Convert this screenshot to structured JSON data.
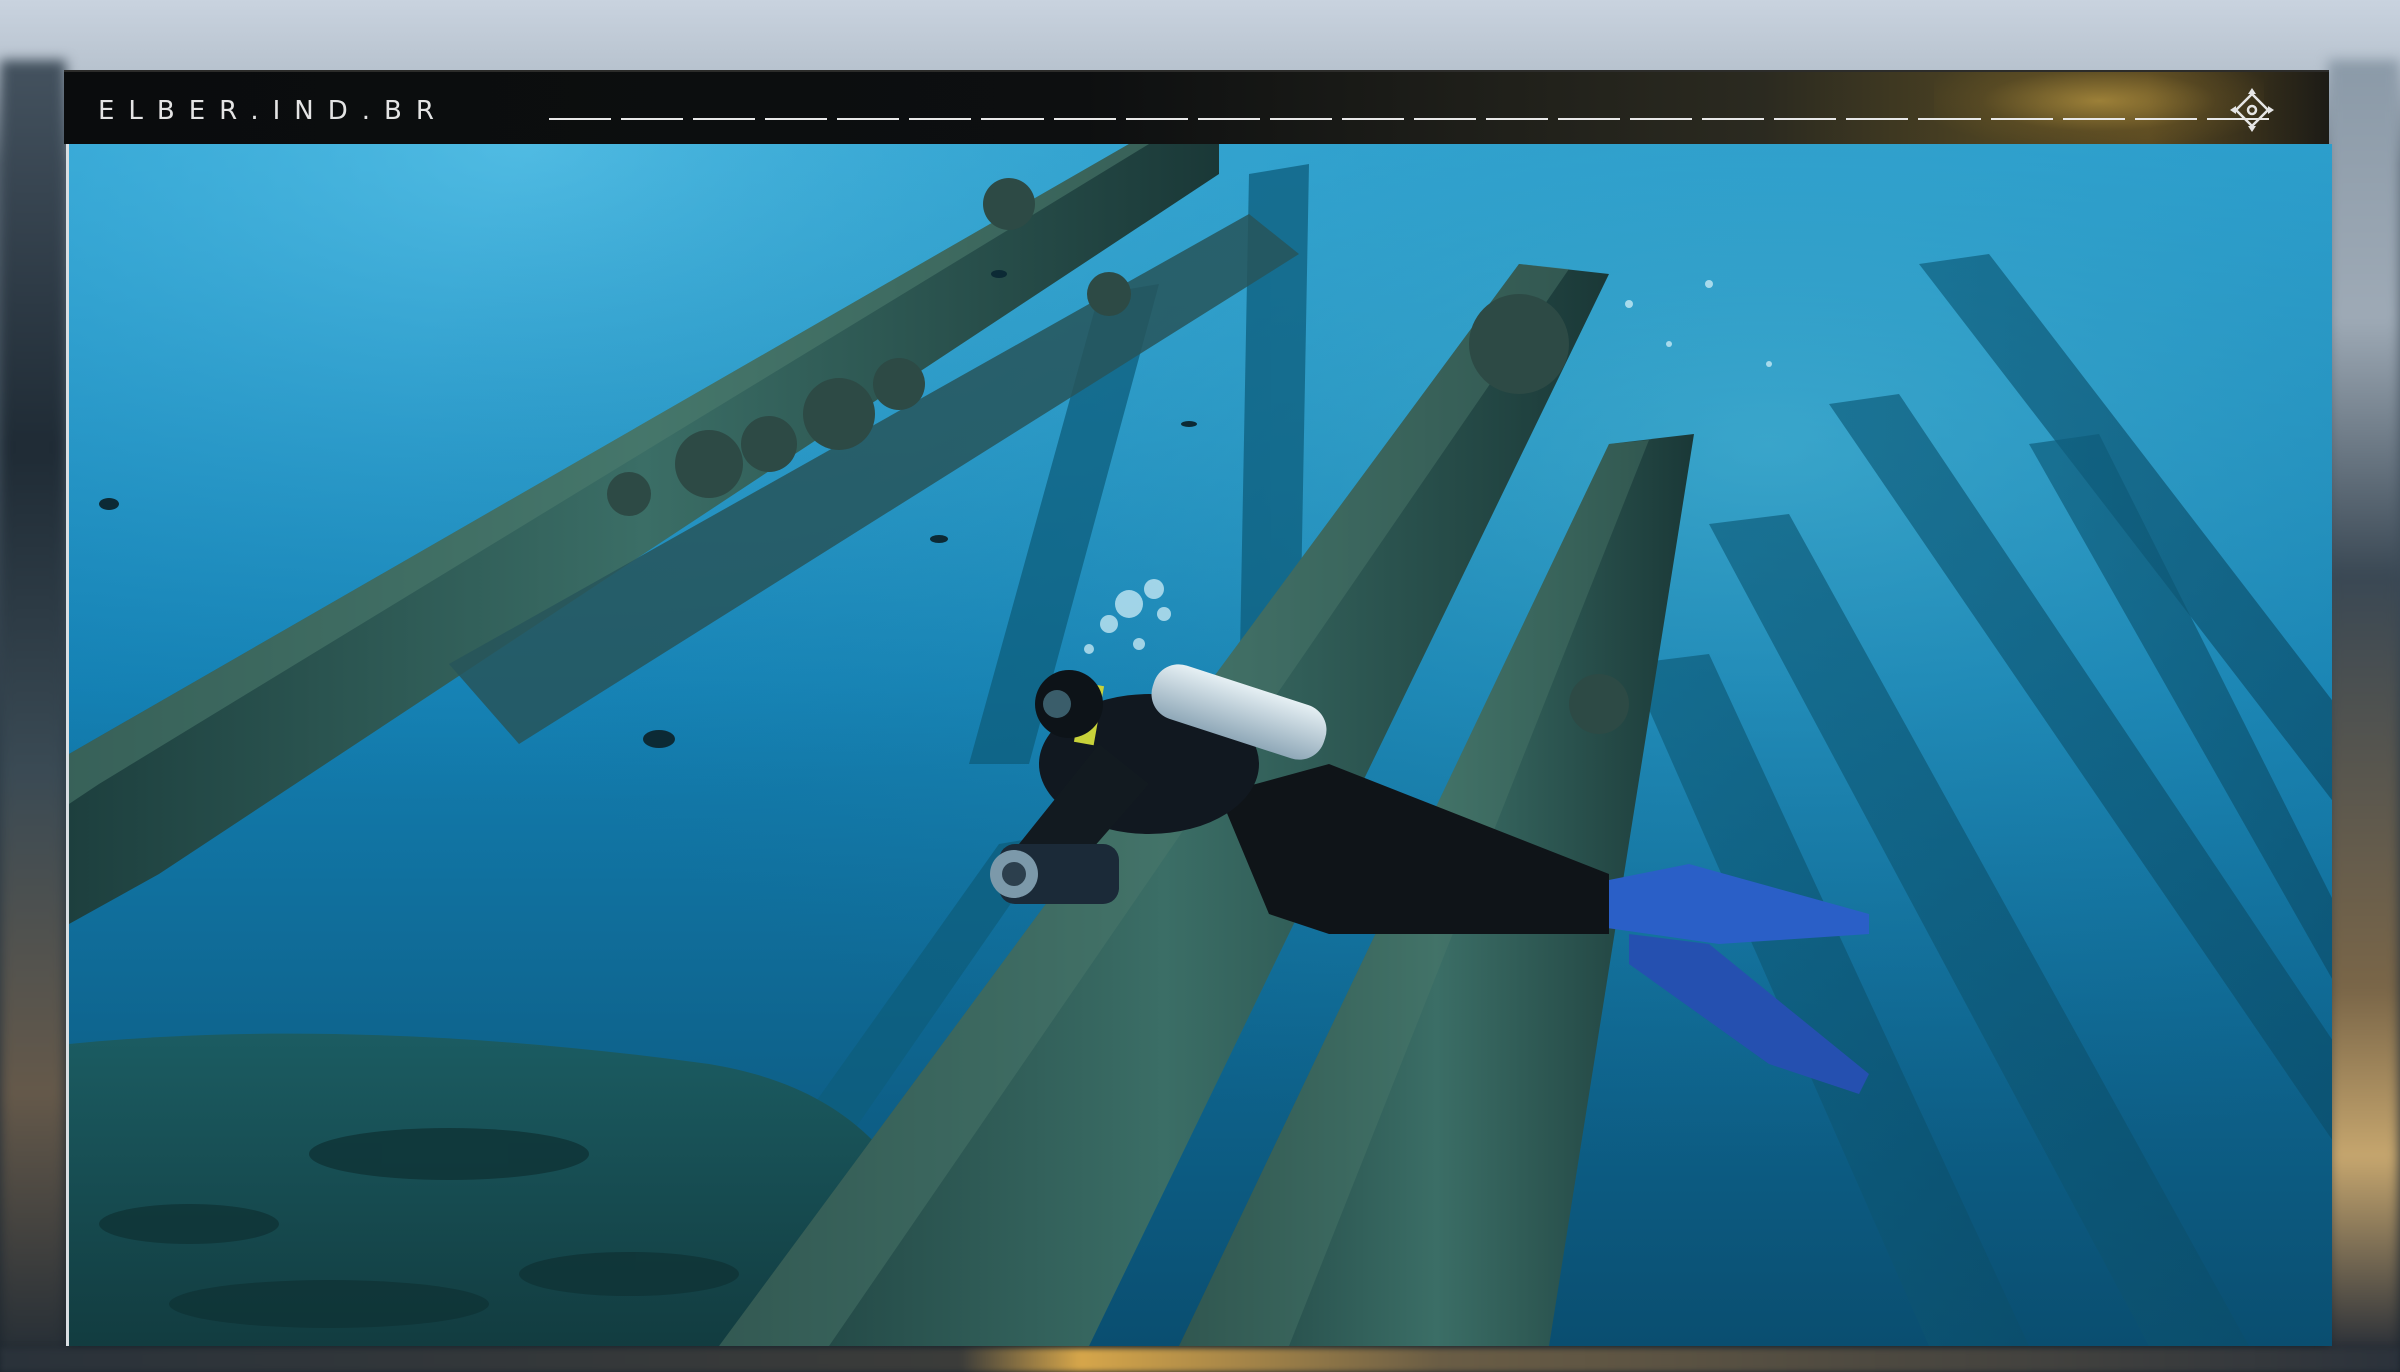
{
  "site": {
    "brand_title": "ELBER.IND.BR"
  },
  "header": {
    "navigation_icon": "crosshair-move-icon"
  },
  "photo": {
    "subject": "scuba-diver-photo",
    "colors": {
      "water_light": "#2c9fcf",
      "water_mid": "#137bad",
      "water_deep": "#0a5478",
      "pillar": "#2f5f5a",
      "pillar_dark": "#1f4240",
      "fin_blue": "#2a5fc7",
      "tank_silver": "#c8d8e2"
    }
  }
}
